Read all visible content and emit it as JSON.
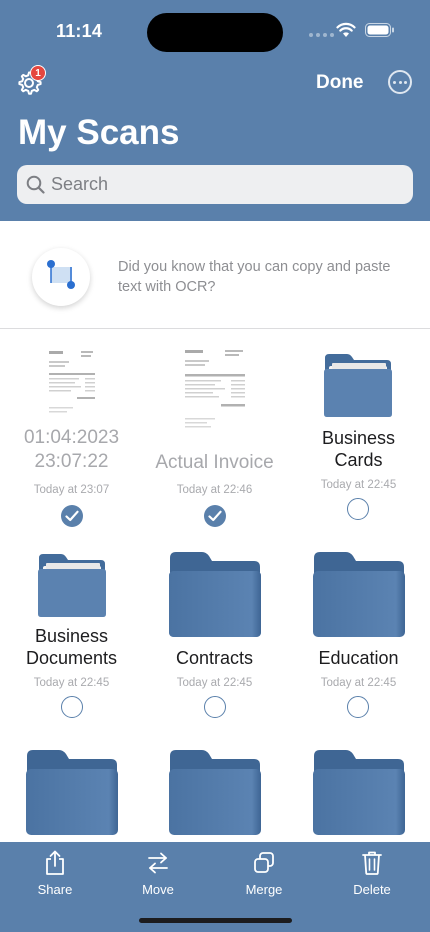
{
  "status_bar": {
    "time": "11:14"
  },
  "header": {
    "settings_badge": "1",
    "done_label": "Done",
    "title": "My Scans"
  },
  "search": {
    "placeholder": "Search"
  },
  "tip": {
    "text": "Did you know that you can copy and paste text with OCR?"
  },
  "items": [
    {
      "kind": "document",
      "name": "01:04:2023 23:07:22",
      "date": "Today at 23:07",
      "selected": true
    },
    {
      "kind": "document",
      "name": "Actual Invoice",
      "date": "Today at 22:46",
      "selected": true
    },
    {
      "kind": "folder",
      "name": "Business Cards",
      "date": "Today at 22:45",
      "selected": false
    },
    {
      "kind": "folder",
      "name": "Business Documents",
      "date": "Today at 22:45",
      "selected": false
    },
    {
      "kind": "folder",
      "name": "Contracts",
      "date": "Today at 22:45",
      "selected": false
    },
    {
      "kind": "folder",
      "name": "Education",
      "date": "Today at 22:45",
      "selected": false
    },
    {
      "kind": "folder",
      "name": "",
      "date": "",
      "selected": false
    },
    {
      "kind": "folder",
      "name": "",
      "date": "",
      "selected": false
    },
    {
      "kind": "folder",
      "name": "",
      "date": "",
      "selected": false
    }
  ],
  "toolbar": {
    "share_label": "Share",
    "move_label": "Move",
    "merge_label": "Merge",
    "delete_label": "Delete"
  },
  "colors": {
    "brand": "#5a80ab",
    "folder": "#4f77a6",
    "badge": "#e5473f"
  }
}
